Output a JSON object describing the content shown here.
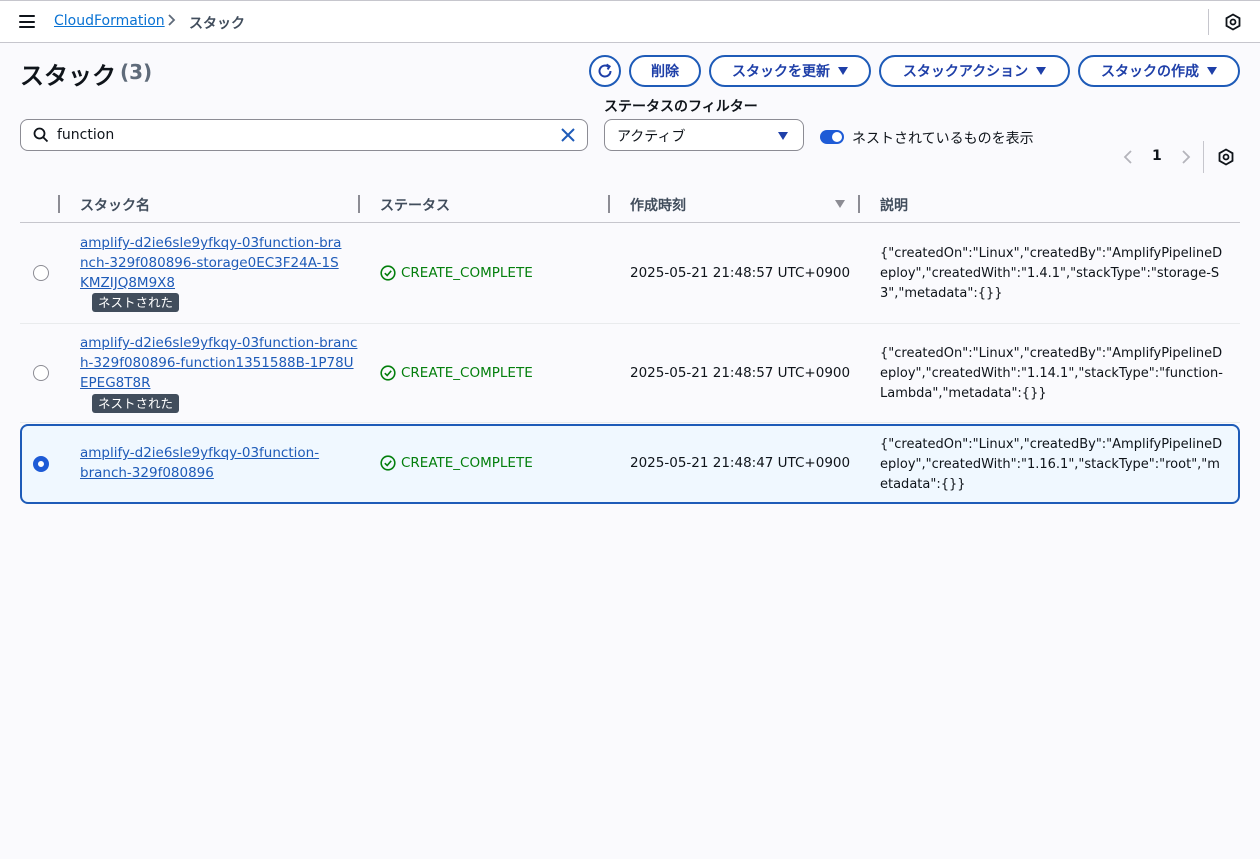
{
  "breadcrumb": {
    "service": "CloudFormation",
    "current": "スタック"
  },
  "page": {
    "title": "スタック",
    "count": "(3)"
  },
  "toolbar": {
    "delete_label": "削除",
    "update_label": "スタックを更新",
    "actions_label": "スタックアクション",
    "create_label": "スタックの作成"
  },
  "search": {
    "value": "function",
    "placeholder": ""
  },
  "filter": {
    "label": "ステータスのフィルター",
    "selected": "アクティブ"
  },
  "nested_toggle": {
    "label": "ネストされているものを表示",
    "on": true
  },
  "pagination": {
    "current_page": "1"
  },
  "table": {
    "columns": [
      "スタック名",
      "ステータス",
      "作成時刻",
      "説明"
    ],
    "rows": [
      {
        "name": "amplify-d2ie6sle9yfkqy-03function-branch-329f080896-storage0EC3F24A-1SKMZIJQ8M9X8",
        "badge": "ネストされた",
        "status": "CREATE_COMPLETE",
        "created": "2025-05-21 21:48:57 UTC+0900",
        "description": "{\"createdOn\":\"Linux\",\"createdBy\":\"AmplifyPipelineDeploy\",\"createdWith\":\"1.4.1\",\"stackType\":\"storage-S3\",\"metadata\":{}}",
        "selected": false
      },
      {
        "name": "amplify-d2ie6sle9yfkqy-03function-branch-329f080896-function1351588B-1P78UEPEG8T8R",
        "badge": "ネストされた",
        "status": "CREATE_COMPLETE",
        "created": "2025-05-21 21:48:57 UTC+0900",
        "description": "{\"createdOn\":\"Linux\",\"createdBy\":\"AmplifyPipelineDeploy\",\"createdWith\":\"1.14.1\",\"stackType\":\"function-Lambda\",\"metadata\":{}}",
        "selected": false
      },
      {
        "name": "amplify-d2ie6sle9yfkqy-03function-branch-329f080896",
        "badge": "",
        "status": "CREATE_COMPLETE",
        "created": "2025-05-21 21:48:47 UTC+0900",
        "description": "{\"createdOn\":\"Linux\",\"createdBy\":\"AmplifyPipelineDeploy\",\"createdWith\":\"1.16.1\",\"stackType\":\"root\",\"metadata\":{}}",
        "selected": true
      }
    ]
  },
  "colors": {
    "accent": "#1e5bb8",
    "success": "#037f0c",
    "badge_bg": "#414d5c"
  },
  "icons": [
    "menu-icon",
    "chevron-right-icon",
    "settings-icon",
    "refresh-icon",
    "search-icon",
    "close-icon",
    "caret-down-icon",
    "check-circle-icon"
  ]
}
